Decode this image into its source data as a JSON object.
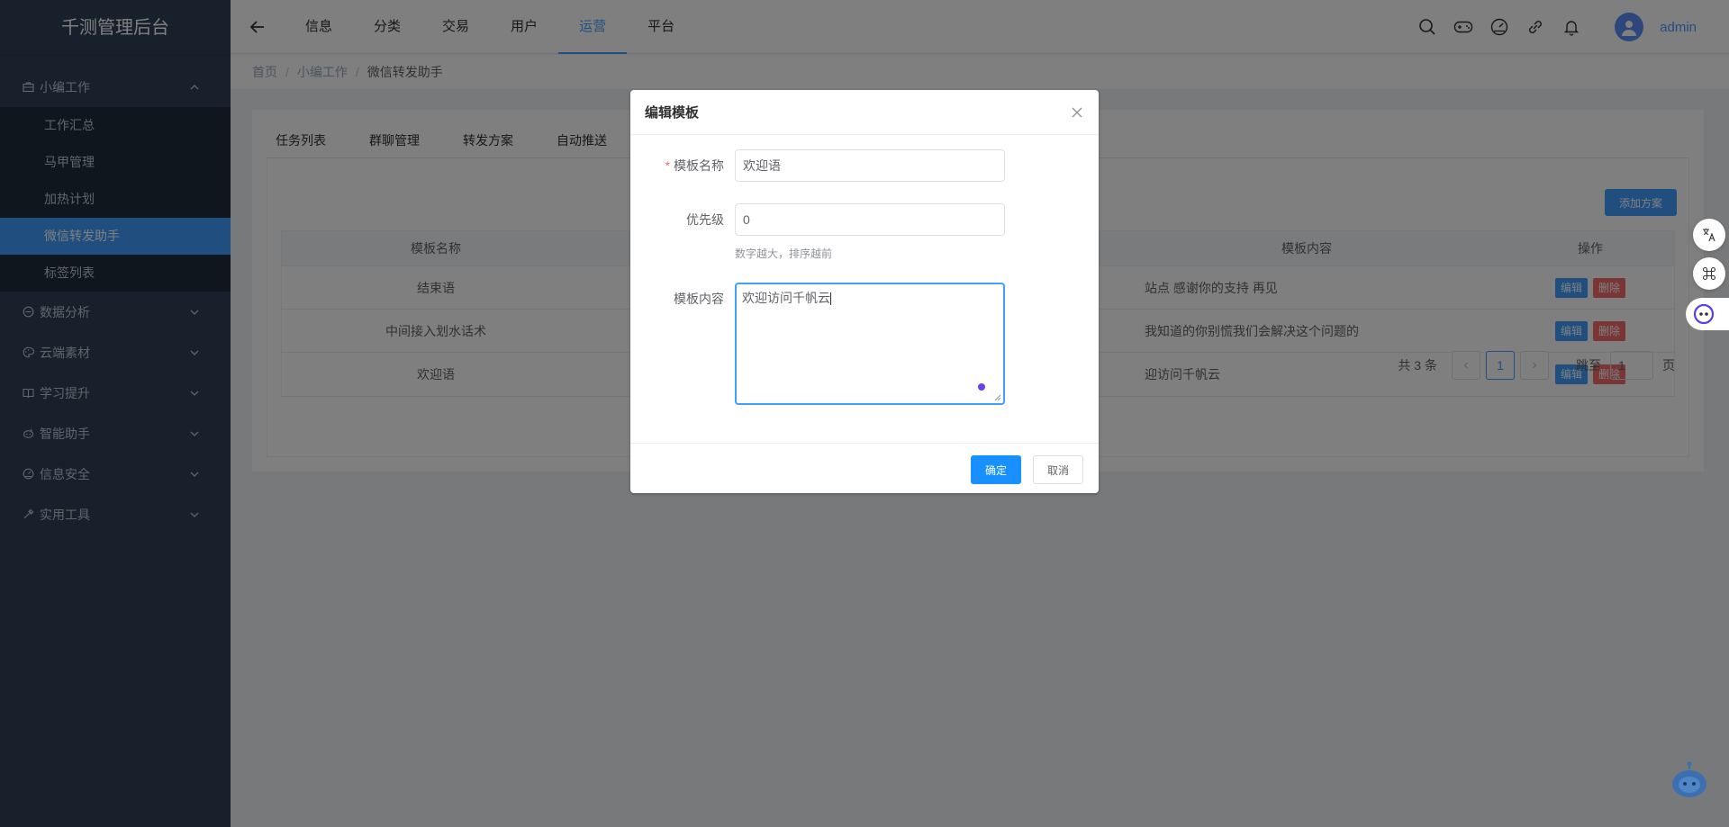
{
  "sidebar": {
    "logo": "千测管理后台",
    "groups": [
      {
        "label": "小编工作",
        "icon": "briefcase-icon",
        "expanded": true,
        "items": [
          {
            "label": "工作汇总"
          },
          {
            "label": "马甲管理"
          },
          {
            "label": "加热计划"
          },
          {
            "label": "微信转发助手",
            "active": true
          },
          {
            "label": "标签列表"
          }
        ]
      },
      {
        "label": "数据分析",
        "icon": "chart-icon"
      },
      {
        "label": "云端素材",
        "icon": "palette-icon"
      },
      {
        "label": "学习提升",
        "icon": "book-icon"
      },
      {
        "label": "智能助手",
        "icon": "bot-icon"
      },
      {
        "label": "信息安全",
        "icon": "dashboard-icon"
      },
      {
        "label": "实用工具",
        "icon": "tool-icon"
      }
    ]
  },
  "header": {
    "nav": [
      {
        "label": "信息"
      },
      {
        "label": "分类"
      },
      {
        "label": "交易"
      },
      {
        "label": "用户"
      },
      {
        "label": "运营",
        "active": true
      },
      {
        "label": "平台"
      }
    ],
    "icons": [
      "search-icon",
      "gamepad-icon",
      "speedometer-icon",
      "link-icon",
      "bell-icon"
    ],
    "username": "admin"
  },
  "breadcrumb": {
    "items": [
      "首页",
      "小编工作"
    ],
    "current": "微信转发助手"
  },
  "content": {
    "tabs": [
      "任务列表",
      "群聊管理",
      "转发方案",
      "自动推送"
    ],
    "add_button": "添加方案",
    "table": {
      "headers": [
        "模板名称",
        "",
        "模板内容",
        "操作"
      ],
      "rows": [
        {
          "name": "结束语",
          "content": "站点 感谢你的支持 再见"
        },
        {
          "name": "中间接入划水话术",
          "content": "我知道的你别慌我们会解决这个问题的"
        },
        {
          "name": "欢迎语",
          "content": "迎访问千帆云"
        }
      ],
      "edit_label": "编辑",
      "delete_label": "删除"
    },
    "pagination": {
      "total": "共 3 条",
      "current_page": "1",
      "jump_label": "跳至",
      "jump_value": "1",
      "page_suffix": "页"
    }
  },
  "dialog": {
    "title": "编辑模板",
    "required_mark": "*",
    "fields": {
      "name_label": "模板名称",
      "name_value": "欢迎语",
      "priority_label": "优先级",
      "priority_value": "0",
      "priority_hint": "数字越大，排序越前",
      "content_label": "模板内容",
      "content_value": "欢迎访问千帆云"
    },
    "confirm": "确定",
    "cancel": "取消"
  },
  "colors": {
    "primary": "#409eff",
    "danger": "#f56c6c",
    "sidebar_bg": "#304156",
    "sidebar_sub_bg": "#1f2d3d"
  }
}
